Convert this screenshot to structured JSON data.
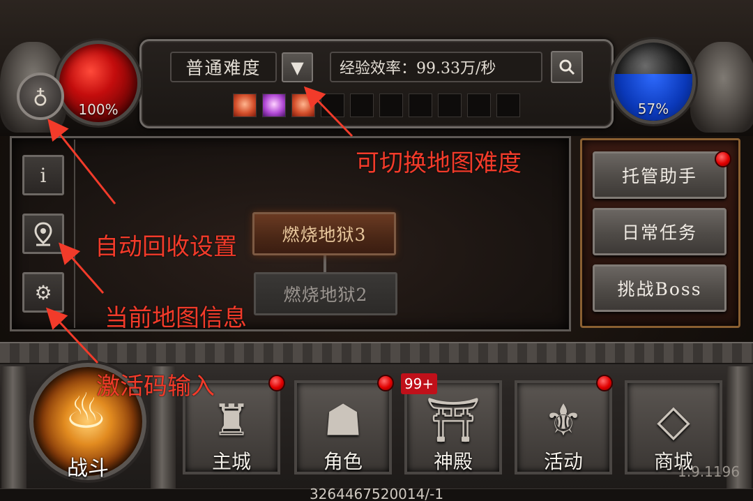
{
  "hud": {
    "hp_percent": "100%",
    "mp_percent": "57%",
    "difficulty_label": "普通难度",
    "exp_rate": "经验效率：99.33万/秒"
  },
  "buffs": [
    "fire",
    "purple",
    "fire"
  ],
  "map": {
    "nodes": [
      {
        "label": "燃烧地狱3",
        "state": "active"
      },
      {
        "label": "燃烧地狱2",
        "state": "inactive"
      }
    ]
  },
  "right_menu": [
    {
      "label": "托管助手",
      "has_notice": true
    },
    {
      "label": "日常任务",
      "has_notice": false
    },
    {
      "label": "挑战Boss",
      "has_notice": false
    }
  ],
  "bottom_nav": {
    "battle_label": "战斗",
    "items": [
      {
        "label": "主城",
        "icon": "castle-icon",
        "has_notice": true
      },
      {
        "label": "角色",
        "icon": "helmet-icon",
        "has_notice": true
      },
      {
        "label": "神殿",
        "icon": "temple-icon",
        "badge": "99+"
      },
      {
        "label": "活动",
        "icon": "banner-icon",
        "has_notice": true
      },
      {
        "label": "商城",
        "icon": "diamond-icon",
        "has_notice": false
      }
    ]
  },
  "version": "1.9.1196",
  "uid": "3264467520014/-1",
  "annotations": {
    "difficulty": "可切换地图难度",
    "recycle": "自动回收设置",
    "map_info": "当前地图信息",
    "activation": "激活码输入"
  },
  "colors": {
    "annotation": "#f23b2a",
    "notice_dot": "#e00000",
    "hp_orb": "#c40d0d",
    "mp_orb": "#0a38b8"
  }
}
